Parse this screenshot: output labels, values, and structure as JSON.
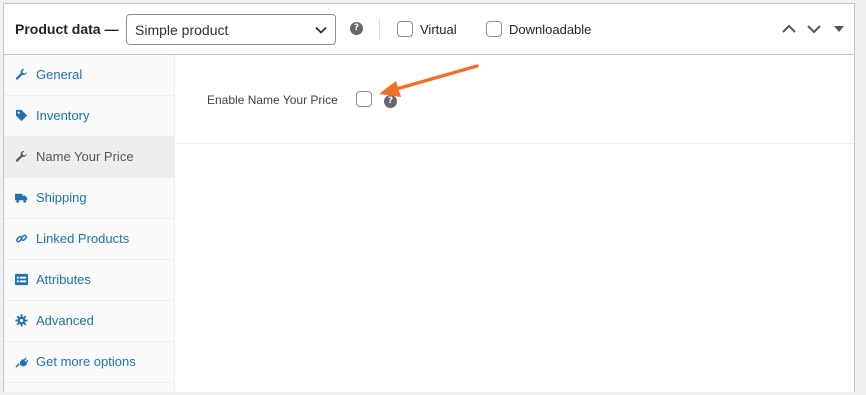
{
  "header": {
    "title": "Product data —",
    "product_type": "Simple product",
    "virtual_label": "Virtual",
    "downloadable_label": "Downloadable",
    "help_icon": "question-mark-icon",
    "collapse_icons": [
      "chevron-up-icon",
      "chevron-down-icon",
      "triangle-down-icon"
    ]
  },
  "tabs": [
    {
      "label": "General",
      "icon": "wrench-icon",
      "active": false
    },
    {
      "label": "Inventory",
      "icon": "tag-icon",
      "active": false
    },
    {
      "label": "Name Your Price",
      "icon": "wrench-icon",
      "active": true
    },
    {
      "label": "Shipping",
      "icon": "truck-icon",
      "active": false
    },
    {
      "label": "Linked Products",
      "icon": "link-icon",
      "active": false
    },
    {
      "label": "Attributes",
      "icon": "list-view-icon",
      "active": false
    },
    {
      "label": "Advanced",
      "icon": "gear-icon",
      "active": false
    },
    {
      "label": "Get more options",
      "icon": "plugin-icon",
      "active": false
    }
  ],
  "main": {
    "enable_label": "Enable Name Your Price",
    "help_icon": "question-mark-icon"
  },
  "colors": {
    "link": "#2271b1",
    "border": "#c3c4c7",
    "active_tab_bg": "#eeeeee",
    "annotation_arrow": "#f56e28"
  }
}
